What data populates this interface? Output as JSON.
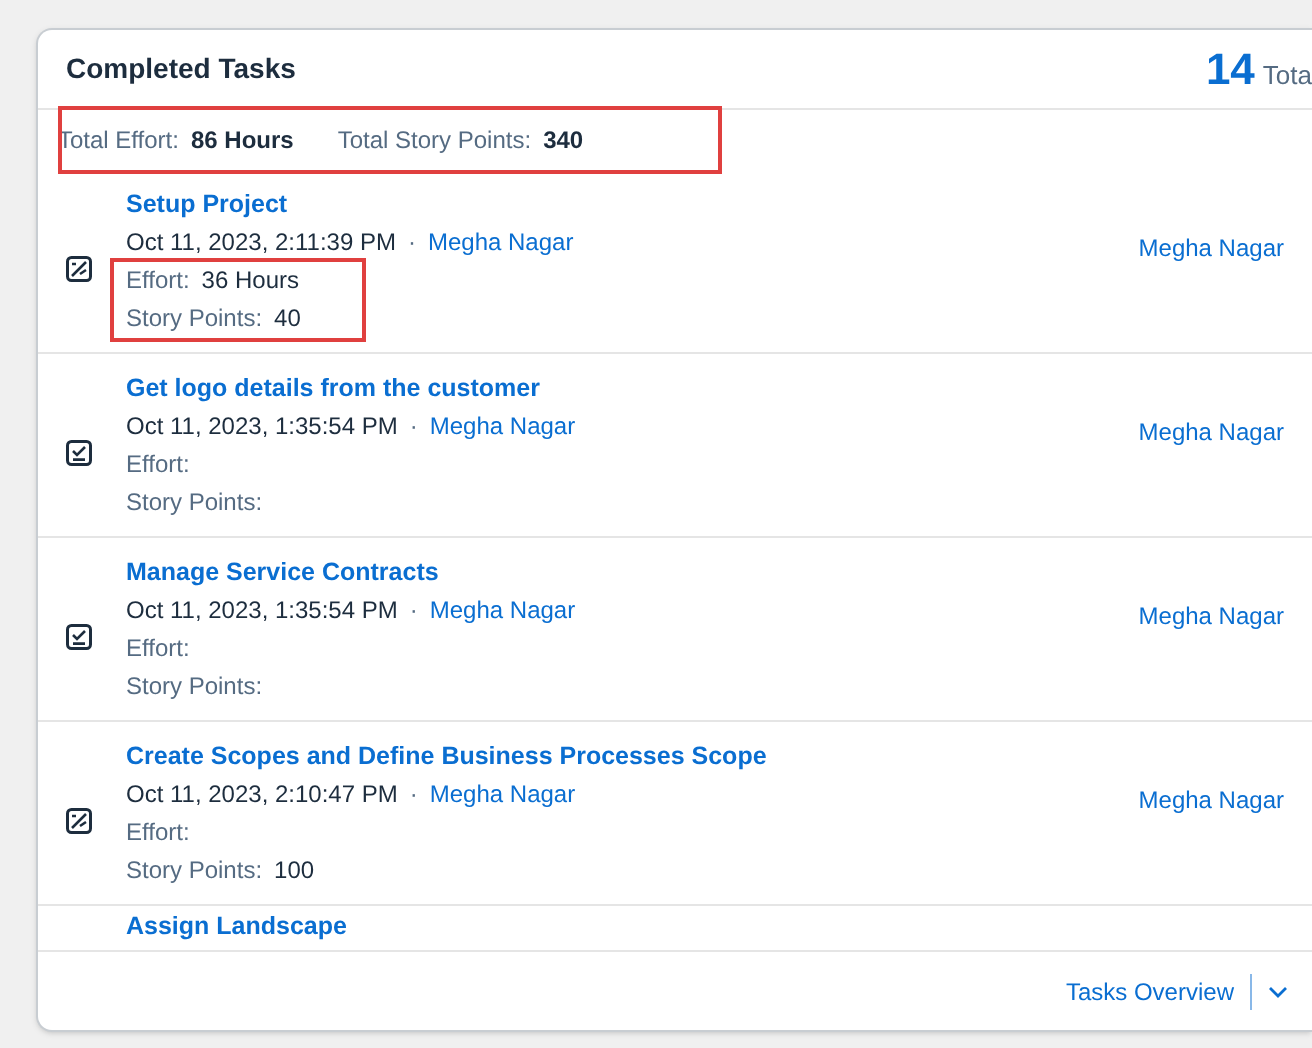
{
  "card": {
    "title": "Completed Tasks",
    "count": "14",
    "count_label": "Tota"
  },
  "summary": {
    "highlighted": true,
    "items": [
      {
        "label": "Total Effort:",
        "value": "86 Hours"
      },
      {
        "label": "Total Story Points:",
        "value": "340"
      }
    ]
  },
  "tasks": [
    {
      "kind": "project",
      "title": "Setup Project",
      "timestamp": "Oct 11, 2023, 2:11:39 PM",
      "separator": "·",
      "owner": "Megha Nagar",
      "assignee": "Megha Nagar",
      "effort_label": "Effort:",
      "effort": "36 Hours",
      "points_label": "Story Points:",
      "points": "40",
      "highlighted": true
    },
    {
      "kind": "task",
      "title": "Get logo details from the customer",
      "timestamp": "Oct 11, 2023, 1:35:54 PM",
      "separator": "·",
      "owner": "Megha Nagar",
      "assignee": "Megha Nagar",
      "effort_label": "Effort:",
      "points_label": "Story Points:",
      "highlighted": false
    },
    {
      "kind": "task",
      "title": "Manage Service Contracts",
      "timestamp": "Oct 11, 2023, 1:35:54 PM",
      "separator": "·",
      "owner": "Megha Nagar",
      "assignee": "Megha Nagar",
      "effort_label": "Effort:",
      "points_label": "Story Points:",
      "highlighted": false
    },
    {
      "kind": "project",
      "title": "Create Scopes and Define Business Processes Scope",
      "timestamp": "Oct 11, 2023, 2:10:47 PM",
      "separator": "·",
      "owner": "Megha Nagar",
      "assignee": "Megha Nagar",
      "effort_label": "Effort:",
      "points_label": "Story Points:",
      "points": "100",
      "highlighted": false
    },
    {
      "kind": "partial",
      "title": "Assign Landscape"
    }
  ],
  "footer": {
    "link": "Tasks Overview"
  }
}
